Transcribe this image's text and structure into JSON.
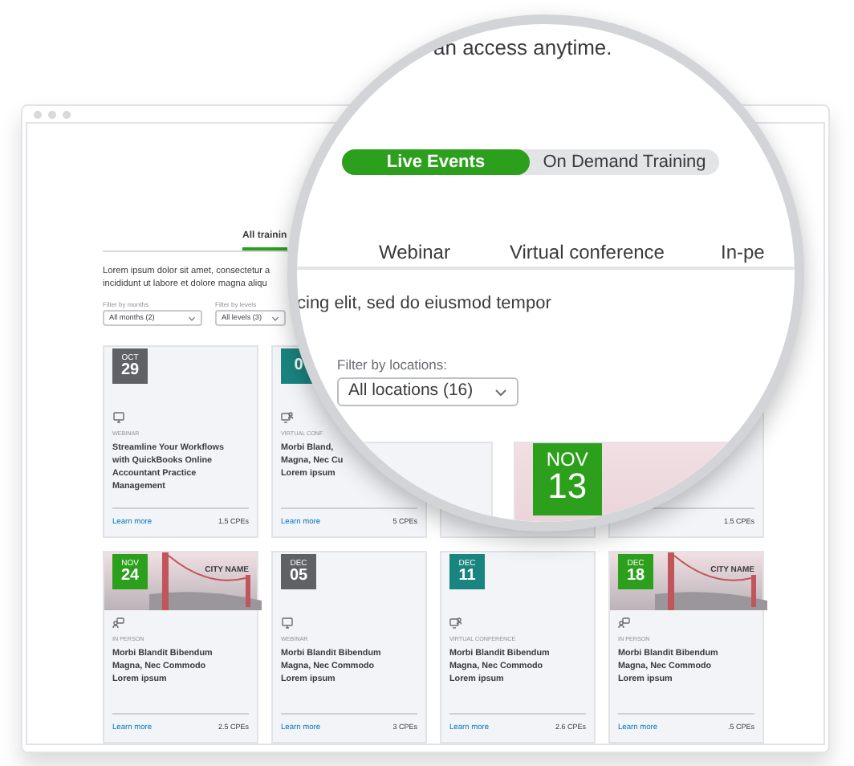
{
  "lens": {
    "headline": "an access anytime.",
    "toggle": [
      {
        "label": "Live Events",
        "selected": true
      },
      {
        "label": "On Demand Training",
        "selected": false
      }
    ],
    "type_tabs": [
      {
        "label": "Webinar"
      },
      {
        "label": "Virtual conference"
      },
      {
        "label": "In-pe"
      }
    ],
    "intro_fragment": "cing elit, sed do eiusmod tempor",
    "location_filter": {
      "label": "Filter by locations:",
      "value": "All locations (16)"
    },
    "card_badge": {
      "month": "NOV",
      "day": "13",
      "color": "#2ca01c"
    }
  },
  "window": {
    "tab": {
      "label": "All trainin",
      "selected": true
    },
    "intro_lines": [
      "Lorem ipsum dolor sit amet, consectetur a",
      "incididunt ut labore et dolore magna aliqu"
    ],
    "filters": [
      {
        "label": "Filter by months",
        "value": "All months (2)"
      },
      {
        "label": "Filter by levels",
        "value": "All levels (3)"
      }
    ],
    "cards": [
      {
        "kind": "webinar",
        "month": "OCT",
        "day": "29",
        "color": "#5f6166",
        "type": "WEBINAR",
        "title_lines": [
          "Streamline Your Workflows",
          "with QuickBooks Online",
          "Accountant Practice",
          "Management"
        ],
        "link": "Learn more",
        "cpes": "1.5 CPEs"
      },
      {
        "kind": "virtual",
        "day": "0",
        "color": "#1a8580",
        "type": "VIRTUAL CONF",
        "title_lines": [
          "Morbi Bland,",
          "Magna, Nec Cu",
          "Lorem ipsum"
        ],
        "link": "Learn more",
        "cpes": "5 CPEs"
      },
      {
        "kind": "hidden"
      },
      {
        "kind": "hidden",
        "cpes": "1.5 CPEs"
      },
      {
        "kind": "in_person",
        "month": "NOV",
        "day": "24",
        "color": "#2ca01c",
        "photo": true,
        "city": "CITY NAME",
        "type": "IN PERSON",
        "title_lines": [
          "Morbi Blandit Bibendum",
          "Magna, Nec Commodo",
          "Lorem ipsum"
        ],
        "link": "Learn more",
        "cpes": "2.5 CPEs"
      },
      {
        "kind": "webinar",
        "month": "DEC",
        "day": "05",
        "color": "#5f6166",
        "type": "WEBINAR",
        "title_lines": [
          "Morbi Blandit Bibendum",
          "Magna, Nec Commodo",
          "Lorem ipsum"
        ],
        "link": "Learn more",
        "cpes": "3 CPEs"
      },
      {
        "kind": "virtual",
        "month": "DEC",
        "day": "11",
        "color": "#1a8580",
        "type": "VIRTUAL CONFERENCE",
        "title_lines": [
          "Morbi Blandit Bibendum",
          "Magna, Nec Commodo",
          "Lorem ipsum"
        ],
        "link": "Learn more",
        "cpes": "2.6 CPEs"
      },
      {
        "kind": "in_person",
        "month": "DEC",
        "day": "18",
        "color": "#2ca01c",
        "photo": true,
        "city": "CITY NAME",
        "type": "IN PERSON",
        "title_lines": [
          "Morbi Blandit Bibendum",
          "Magna, Nec Commodo",
          "Lorem ipsum"
        ],
        "link": "Learn more",
        "cpes": ".5 CPEs"
      }
    ]
  }
}
